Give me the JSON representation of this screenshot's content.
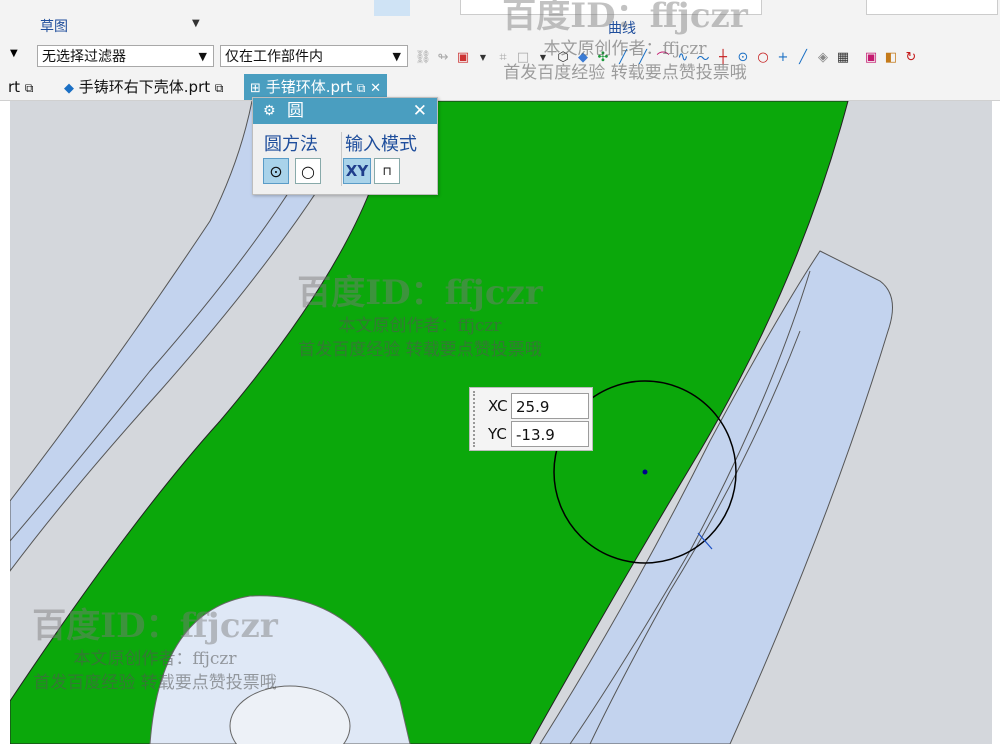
{
  "ribbon": {
    "left_label": "草图",
    "right_label": "曲线"
  },
  "toolbar": {
    "filter_select": "无选择过滤器",
    "scope_select": "仅在工作部件内"
  },
  "tabs": [
    {
      "label": "rt"
    },
    {
      "label": "手铸环右下壳体.prt"
    },
    {
      "label": "手锗环体.prt"
    }
  ],
  "dialog": {
    "title": "圆",
    "method_group": "圆方法",
    "input_group": "输入模式",
    "xy_label": "XY"
  },
  "coords": {
    "xc_label": "XC",
    "xc_value": "25.9",
    "yc_label": "YC",
    "yc_value": "-13.9"
  },
  "watermark": {
    "id_text": "百度ID：ffjczr",
    "author_line": "本文原创作者：ffjczr",
    "publish_line": "首发百度经验 转载要点赞投票哦"
  },
  "colors": {
    "face_green": "#0ba80b",
    "shell_blue": "#c3d3ee",
    "background_gray": "#d4d7dc",
    "accent": "#4a9ec0"
  },
  "icons": [
    "gear-icon",
    "close-icon",
    "circle-center-icon",
    "circle-3pt-icon",
    "plane-input-icon",
    "dropdown-arrow-icon"
  ]
}
